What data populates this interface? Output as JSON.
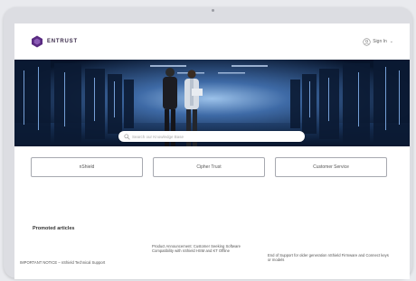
{
  "header": {
    "logo_text": "ENTRUST",
    "signin_label": "Sign In",
    "signin_caret": "⌄",
    "user_icon": "user-circle-icon"
  },
  "colors": {
    "brand": "#5a2b82",
    "hero_dark": "#0b1a33",
    "hero_light": "#7fa8d8"
  },
  "search": {
    "placeholder": "Search our Knowledge Base",
    "icon": "search-icon"
  },
  "product_buttons": [
    {
      "label": "nShield"
    },
    {
      "label": "Cipher Trust"
    },
    {
      "label": "Customer Service"
    }
  ],
  "promoted": {
    "title": "Promoted articles",
    "articles": [
      {
        "text": "IMPORTANT NOTICE – nShield Technical Support"
      },
      {
        "text": "Product Announcement: Customer Seeking Software Compatibility with nShield HSM and KT Offline"
      },
      {
        "text": "End of Support for older generation nShield Firmware and Connect keys or models"
      }
    ]
  }
}
